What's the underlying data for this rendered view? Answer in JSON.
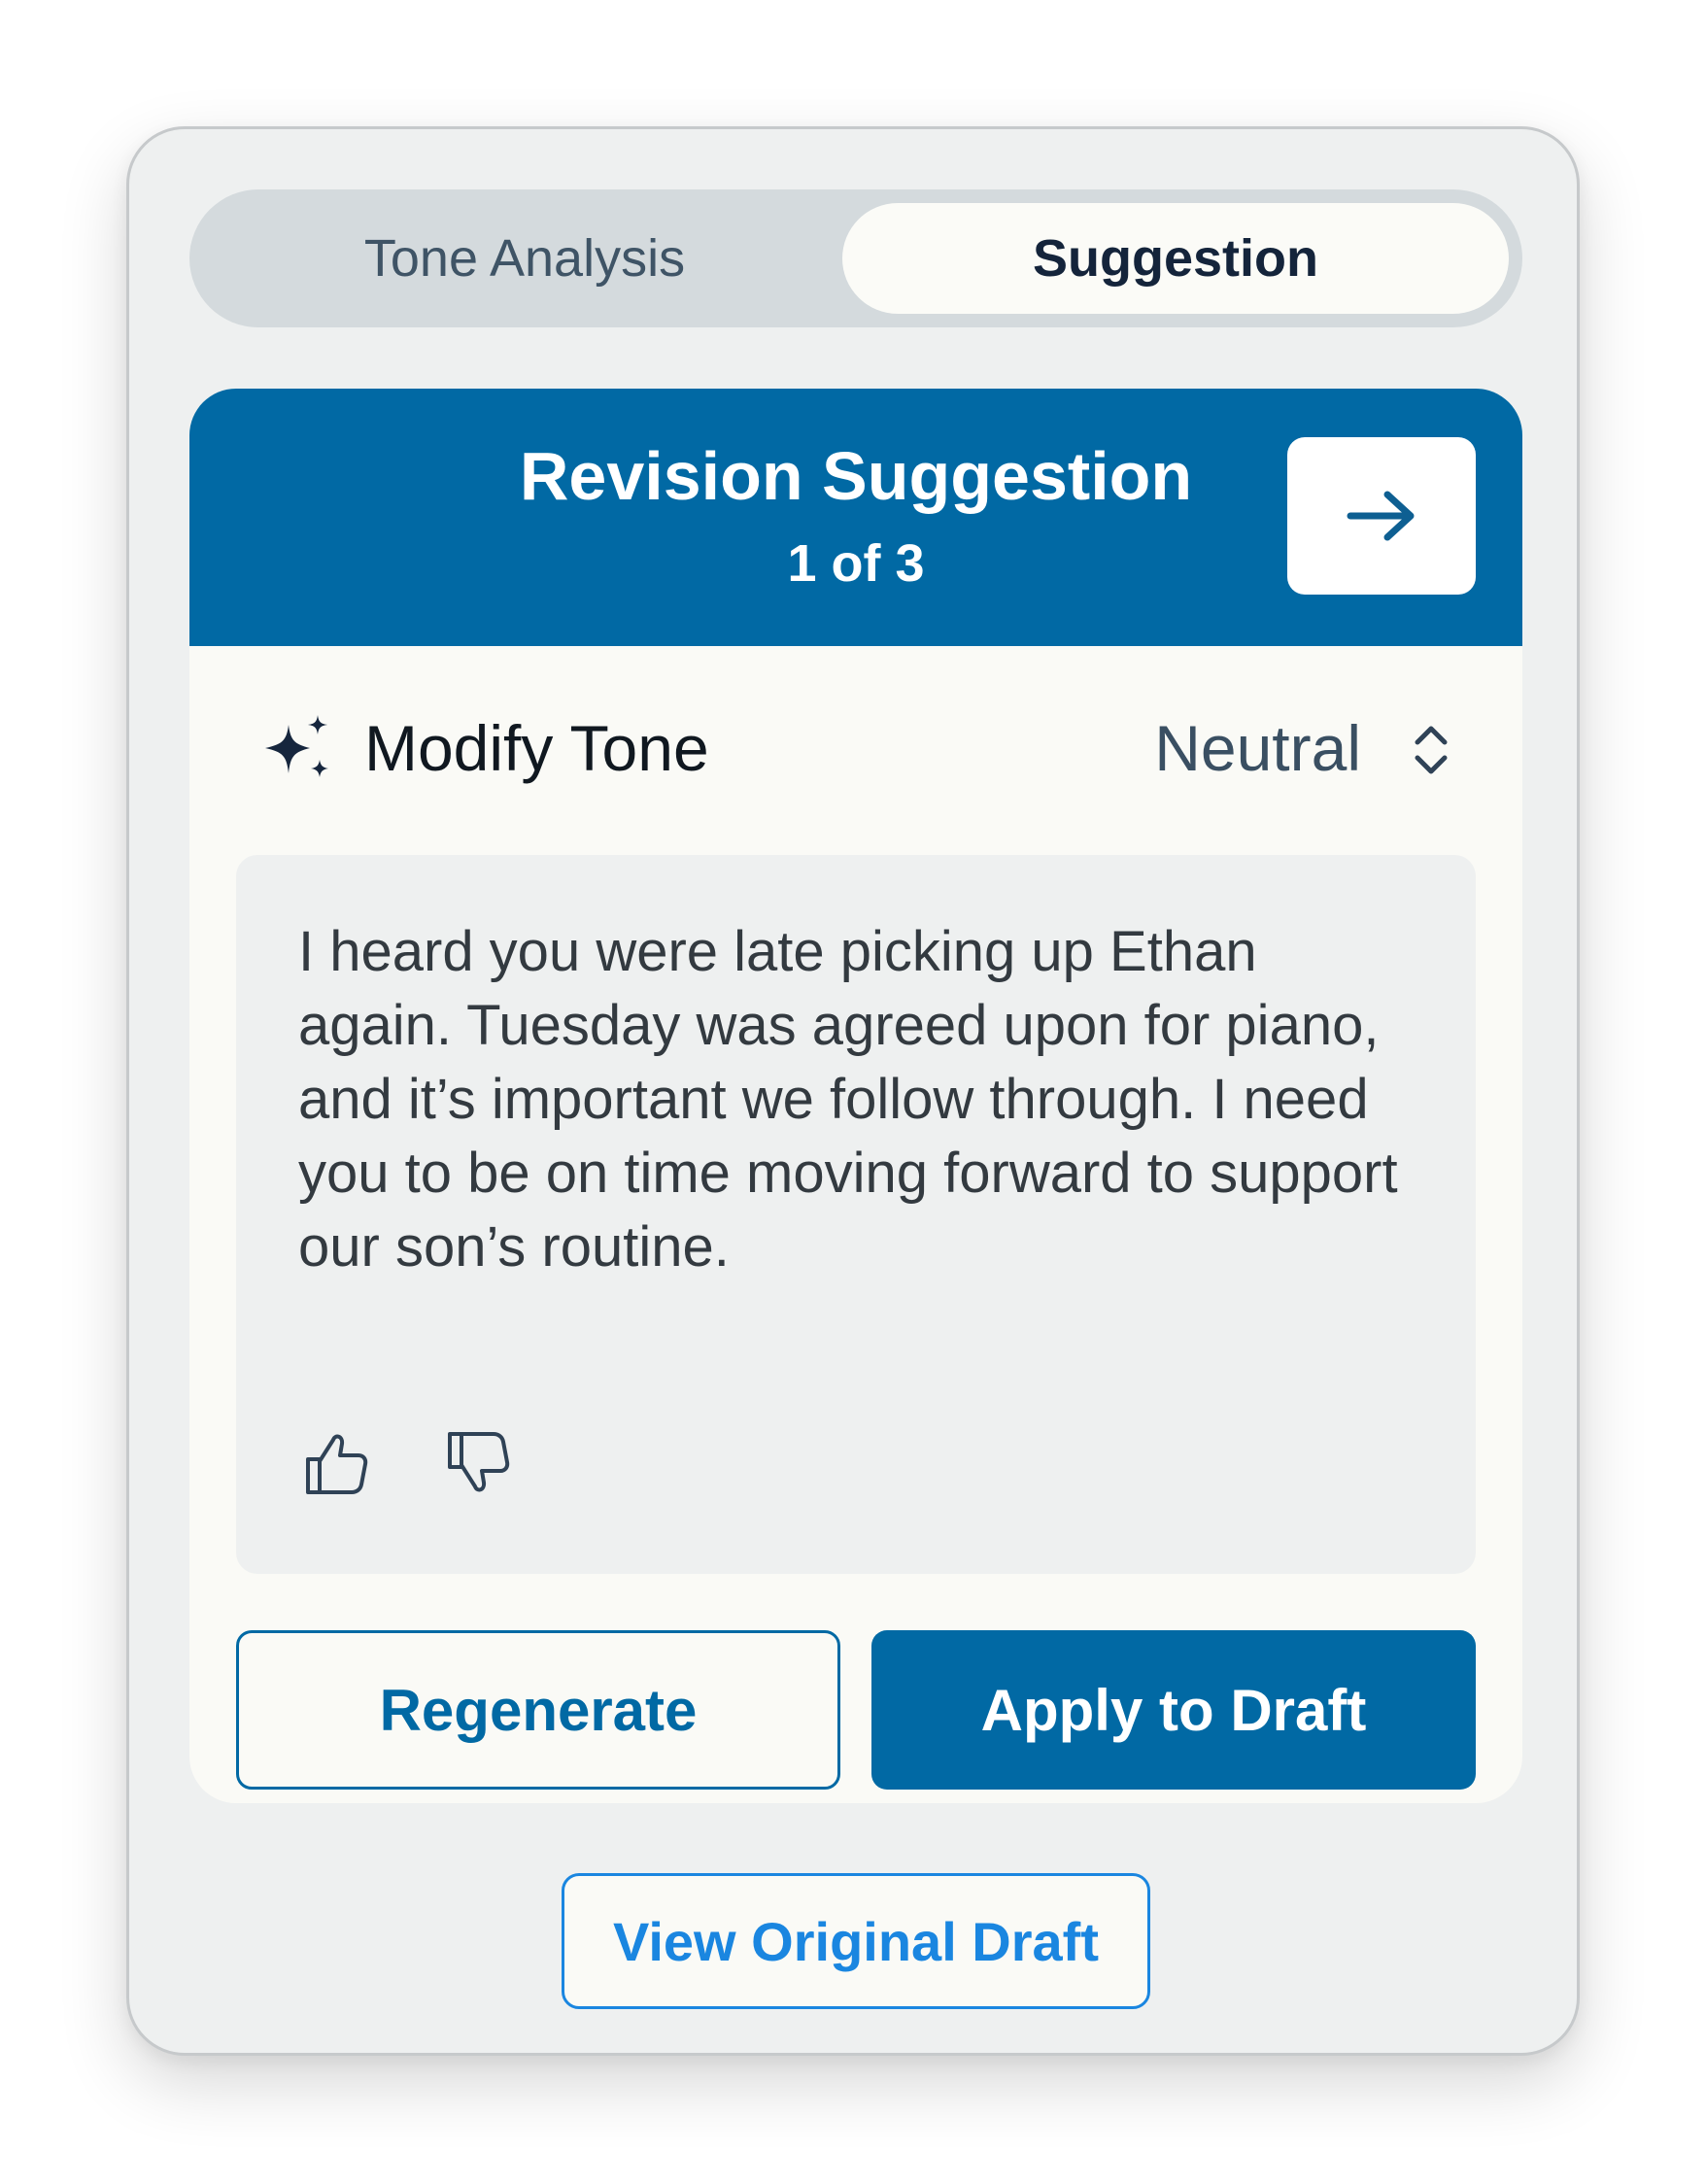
{
  "tabs": [
    {
      "label": "Tone Analysis",
      "active": false
    },
    {
      "label": "Suggestion",
      "active": true
    }
  ],
  "card": {
    "title": "Revision Suggestion",
    "count": "1 of 3",
    "next_icon": "arrow-right-icon"
  },
  "tone": {
    "icon": "sparkles-icon",
    "label": "Modify Tone",
    "value": "Neutral",
    "select_icon": "chevron-up-down-icon"
  },
  "suggestion": {
    "text": "I heard you were late picking up Ethan again. Tuesday was agreed upon for piano, and it’s important we follow through. I need you to be on time moving forward to support our son’s routine.",
    "feedback_icons": [
      "thumbs-up-icon",
      "thumbs-down-icon"
    ]
  },
  "actions": {
    "regenerate_label": "Regenerate",
    "apply_label": "Apply to Draft",
    "view_original_label": "View Original Draft"
  },
  "colors": {
    "primary": "#0169a4",
    "link": "#1a86e0",
    "panel_bg": "#eef0f0",
    "card_bg": "#fafaf6"
  }
}
